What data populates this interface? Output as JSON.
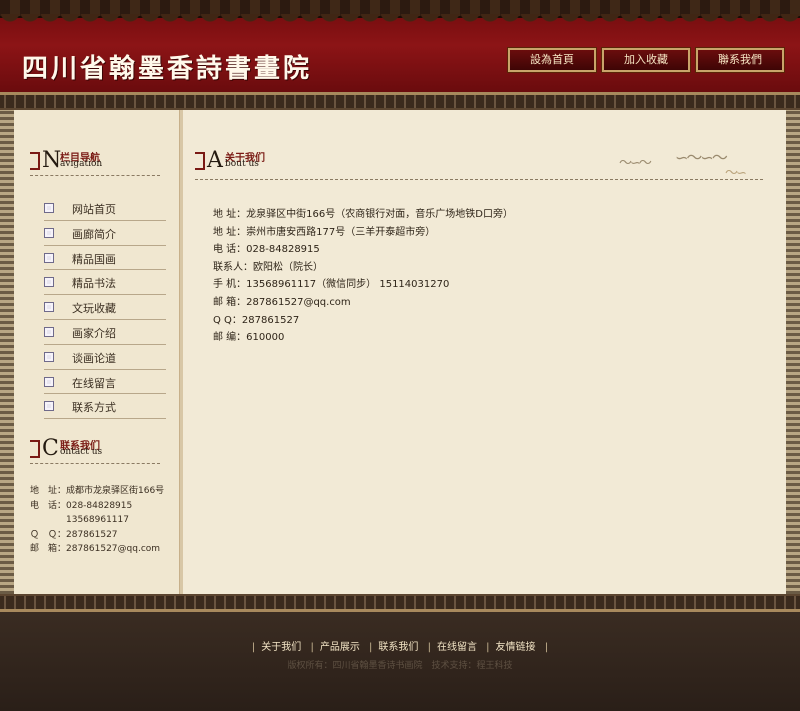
{
  "header": {
    "site_title": "四川省翰墨香詩書畫院",
    "buttons": [
      "設為首頁",
      "加入收藏",
      "聯系我們"
    ]
  },
  "sidebar": {
    "nav_section": {
      "letter": "N",
      "cn": "栏目导航",
      "en": "avigation"
    },
    "menu": [
      "网站首页",
      "画廊简介",
      "精品国画",
      "精品书法",
      "文玩收藏",
      "画家介绍",
      "谈画论道",
      "在线留言",
      "联系方式"
    ],
    "contact_section": {
      "letter": "C",
      "cn": "联系我们",
      "en": "ontact us"
    },
    "contact": [
      {
        "key": "地　址：",
        "value": "成都市龙泉驿区街166号"
      },
      {
        "key": "电　话：",
        "value": "028-84828915"
      },
      {
        "key": "",
        "value": "13568961117"
      },
      {
        "key": "Ｑ　Ｑ：",
        "value": "287861527"
      },
      {
        "key": "邮　箱：",
        "value": "287861527@qq.com"
      }
    ]
  },
  "main": {
    "section": {
      "letter": "A",
      "cn": "关于我们",
      "en": "bout us"
    },
    "info_lines": [
      "地 址：龙泉驿区中街166号（农商银行对面，音乐广场地铁D口旁）",
      "地 址：崇州市唐安西路177号（三羊开泰超市旁）",
      "电 话：028-84828915",
      "联系人：欧阳松（院长）",
      "手 机：13568961117（微信同步）  15114031270",
      "邮 箱：287861527@qq.com",
      "Q Q：287861527",
      "邮 编：610000"
    ]
  },
  "footer": {
    "links": [
      "关于我们",
      "产品展示",
      "联系我们",
      "在线留言",
      "友情链接"
    ],
    "copyright": "版权所有：四川省翰墨香诗书画院　技术支持：程王科技"
  },
  "colors": {
    "header_red": "#8c1416",
    "parchment": "#f2ead6",
    "footer_brown": "#2a1f18"
  }
}
